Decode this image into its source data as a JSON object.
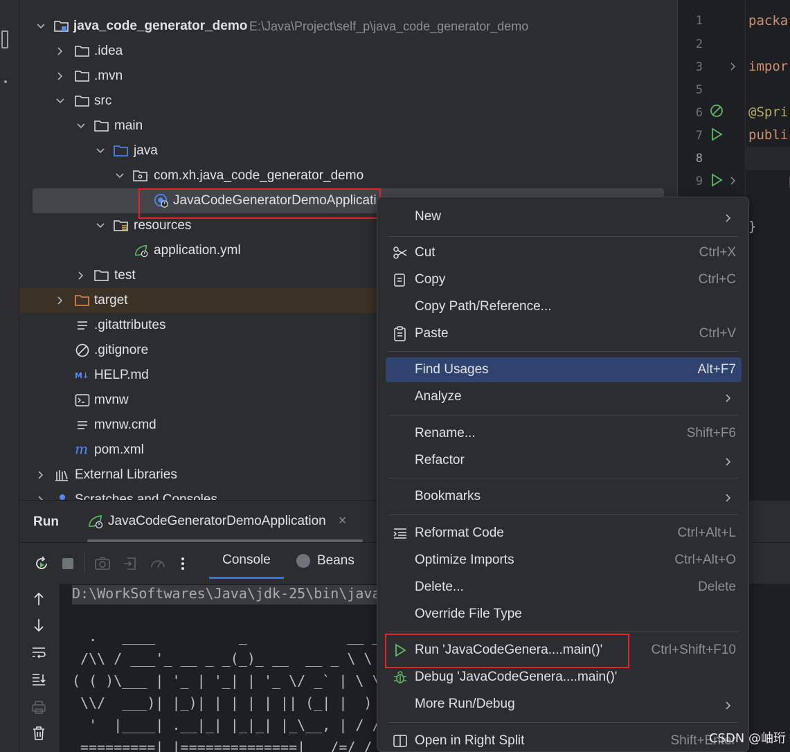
{
  "tree": {
    "root_name": "java_code_generator_demo",
    "root_path": "E:\\Java\\Project\\self_p\\java_code_generator_demo",
    "items": {
      "idea": ".idea",
      "mvn": ".mvn",
      "src": "src",
      "main": "main",
      "java": "java",
      "package": "com.xh.java_code_generator_demo",
      "app_class": "JavaCodeGeneratorDemoApplicati",
      "resources": "resources",
      "app_yml": "application.yml",
      "test": "test",
      "target": "target",
      "gitattributes": ".gitattributes",
      "gitignore": ".gitignore",
      "help": "HELP.md",
      "mvnw": "mvnw",
      "mvnw_cmd": "mvnw.cmd",
      "pom": "pom.xml",
      "external": "External Libraries",
      "scratches": "Scratches and Consoles"
    }
  },
  "editor": {
    "lines": [
      {
        "num": "1",
        "code": "packa"
      },
      {
        "num": "2",
        "code": ""
      },
      {
        "num": "3",
        "code": "impor"
      },
      {
        "num": "5",
        "code": ""
      },
      {
        "num": "6",
        "code": "@Spri"
      },
      {
        "num": "7",
        "code": "publi"
      },
      {
        "num": "8",
        "code": ""
      },
      {
        "num": "9",
        "code": "p"
      },
      {
        "num": "",
        "code": "}"
      }
    ]
  },
  "run_panel": {
    "title": "Run",
    "tab_label": "JavaCodeGeneratorDemoApplication",
    "tab_close": "×",
    "console_tab": "Console",
    "beans_tab": "Beans",
    "console_lines": [
      "D:\\WorkSoftwares\\Java\\jdk-25\\bin\\java",
      "",
      "  .   ____          _            __ _ _",
      " /\\\\ / ___'_ __ _ _(_)_ __  __ _ \\ \\ \\ \\",
      "( ( )\\___ | '_ | '_| | '_ \\/ _` | \\ \\ \\ \\",
      " \\\\/  ___)| |_)| | | | | || (_| |  ) ) ) )",
      "  '  |____| .__|_| |_|_| |_\\__, | / / / /",
      " =========|_|==============|___/=/_/_/_/"
    ]
  },
  "context_menu": {
    "new": "New",
    "cut": "Cut",
    "cut_sc": "Ctrl+X",
    "copy": "Copy",
    "copy_sc": "Ctrl+C",
    "copy_path": "Copy Path/Reference...",
    "paste": "Paste",
    "paste_sc": "Ctrl+V",
    "find_usages": "Find Usages",
    "find_usages_sc": "Alt+F7",
    "analyze": "Analyze",
    "rename": "Rename...",
    "rename_sc": "Shift+F6",
    "refactor": "Refactor",
    "bookmarks": "Bookmarks",
    "reformat": "Reformat Code",
    "reformat_sc": "Ctrl+Alt+L",
    "optimize": "Optimize Imports",
    "optimize_sc": "Ctrl+Alt+O",
    "delete": "Delete...",
    "delete_sc": "Delete",
    "override": "Override File Type",
    "run": "Run 'JavaCodeGenera....main()'",
    "run_sc": "Ctrl+Shift+F10",
    "debug": "Debug 'JavaCodeGenera....main()'",
    "more_run": "More Run/Debug",
    "open_right": "Open in Right Split",
    "open_right_sc": "Shift+Enter"
  },
  "watermark": "CSDN @岫珩",
  "colors": {
    "background": "#2b2d30",
    "editor_bg": "#1e1f22",
    "highlight": "#2e436e",
    "selection_box": "#e0262a",
    "run_green": "#5fb865",
    "folder_blue": "#548af7",
    "target_orange": "#e08855"
  }
}
